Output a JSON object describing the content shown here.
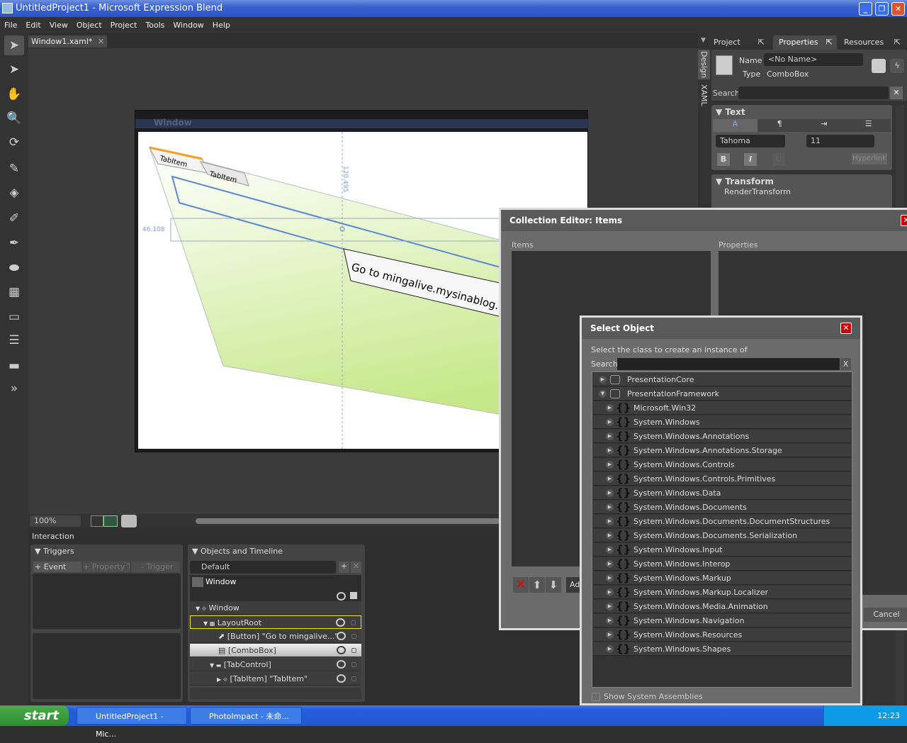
{
  "window": {
    "title": "UntitledProject1 - Microsoft Expression Blend",
    "min": "_",
    "max": "❐",
    "close": "✕"
  },
  "menu": [
    "File",
    "Edit",
    "View",
    "Object",
    "Project",
    "Tools",
    "Window",
    "Help"
  ],
  "doc_tab": {
    "label": "Window1.xaml*",
    "close": "✕"
  },
  "artboard": {
    "window_title": "Window",
    "tab1": "TabItem",
    "tab2": "TabItem",
    "button_text": "Go to mingalive.mysinablog.com",
    "measure_v": "120.495",
    "measure_h": "46.108"
  },
  "zoom": {
    "value": "100%"
  },
  "interaction_label": "Interaction",
  "triggers": {
    "title": "Triggers",
    "event_trigger": "+ Event Trigg",
    "property_trigger": "+ Property Tr",
    "remove_trigger": "- Trigger"
  },
  "objects": {
    "title": "Objects and Timeline",
    "timeline": "Default",
    "root": "Window",
    "tree": [
      {
        "label": "Window"
      },
      {
        "label": "LayoutRoot"
      },
      {
        "label": "[Button] \"Go to mingalive...\""
      },
      {
        "label": "[ComboBox]"
      },
      {
        "label": "[TabControl]"
      },
      {
        "label": "[TabItem] \"TabItem\""
      }
    ]
  },
  "right": {
    "tabs": [
      "Project",
      "Properties",
      "Resources"
    ],
    "side_tabs": [
      "Design",
      "XAML"
    ],
    "name_label": "Name",
    "name_value": "<No Name>",
    "type_label": "Type",
    "type_value": "ComboBox",
    "search_label": "Search",
    "text_section": "Text",
    "font": "Tahoma",
    "font_size": "11",
    "bold": "B",
    "italic": "I",
    "underline": "U",
    "hyperlink": "Hyperlink",
    "transform_section": "Transform",
    "render_transform": "RenderTransform"
  },
  "collection_editor": {
    "title": "Collection Editor: Items",
    "items_label": "Items",
    "properties_label": "Properties",
    "add": "Add",
    "cancel": "Cancel",
    "close": "✕"
  },
  "select_object": {
    "title": "Select Object",
    "instruction": "Select the class to create an instance of",
    "search_label": "Search",
    "search_clear": "X",
    "show_system": "Show System Assemblies",
    "close": "✕",
    "assemblies": [
      "PresentationCore",
      "PresentationFramework"
    ],
    "namespaces": [
      "Microsoft.Win32",
      "System.Windows",
      "System.Windows.Annotations",
      "System.Windows.Annotations.Storage",
      "System.Windows.Controls",
      "System.Windows.Controls.Primitives",
      "System.Windows.Data",
      "System.Windows.Documents",
      "System.Windows.Documents.DocumentStructures",
      "System.Windows.Documents.Serialization",
      "System.Windows.Input",
      "System.Windows.Interop",
      "System.Windows.Markup",
      "System.Windows.Markup.Localizer",
      "System.Windows.Media.Animation",
      "System.Windows.Navigation",
      "System.Windows.Resources",
      "System.Windows.Shapes"
    ]
  },
  "taskbar": {
    "start": "start",
    "items": [
      "UntitledProject1 - Mic...",
      "PhotoImpact - 未命..."
    ],
    "clock": "12:23"
  },
  "colors": {
    "accent_blue": "#5b86d6",
    "selection_yellow": "#e8e020",
    "close_red": "#cc0000"
  }
}
